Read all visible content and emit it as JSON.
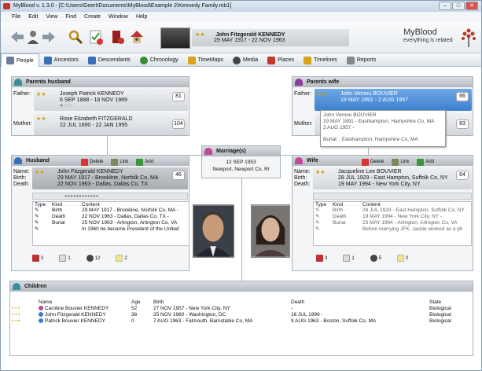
{
  "app": {
    "title": "MyBlood v. 1.3.0 - [C:\\Users\\Geert\\Documents\\MyBlood\\Example 2\\Kennedy Family.mb1]",
    "brand": "MyBlood",
    "tagline": "everything is related"
  },
  "window_controls": [
    "–",
    "□",
    "✕"
  ],
  "menu": [
    "File",
    "Edit",
    "View",
    "Find",
    "Create",
    "Window",
    "Help"
  ],
  "header": {
    "name": "John Fitzgerald KENNEDY",
    "dates": "29 MAY 1917 - 22 NOV 1963",
    "stars": "★★"
  },
  "tabs": [
    {
      "label": "People",
      "icon": "people-icon",
      "color": "#6a7c96",
      "active": true
    },
    {
      "label": "Ancestors",
      "icon": "ancestors-icon",
      "color": "#3b6fb6"
    },
    {
      "label": "Descendants",
      "icon": "descendants-icon",
      "color": "#3b6fb6"
    },
    {
      "label": "Chronology",
      "icon": "chronology-icon",
      "color": "#3a8a3a"
    },
    {
      "label": "TimeMaps",
      "icon": "timemaps-icon",
      "color": "#d9a21b"
    },
    {
      "label": "Media",
      "icon": "media-icon",
      "color": "#444"
    },
    {
      "label": "Places",
      "icon": "places-icon",
      "color": "#c0392b"
    },
    {
      "label": "Timelines",
      "icon": "timelines-icon",
      "color": "#d9a21b"
    },
    {
      "label": "Reports",
      "icon": "reports-icon",
      "color": "#888"
    }
  ],
  "parents_husband": {
    "title": "Parents husband",
    "father_label": "Father:",
    "father_name": "Joseph Patrick KENNEDY",
    "father_dates": "6 SEP 1888 - 18 NOV 1969",
    "father_num": "81",
    "mother_label": "Mother:",
    "mother_name": "Rose Elizabeth FITZGERALD",
    "mother_dates": "22 JUL 1890 - 22 JAN 1995",
    "mother_num": "104"
  },
  "parents_wife": {
    "title": "Parents wife",
    "father_label": "Father:",
    "father_name": "John Vernou BOUVIER",
    "father_dates": "19 MAY 1891 - 2 AUG 1957",
    "father_num": "66",
    "mother_label": "Mother:",
    "mother_num": "83"
  },
  "tooltip": {
    "line1": "John Vernou BOUVIER",
    "line2": "19 MAY 1891 - Easthampton, Hampshire Co, MA",
    "line3": "2 AUG 1957 -",
    "line4": "Burial: , Easthampton, Hampshire Co, MA"
  },
  "marriage": {
    "title": "Marriage(s)",
    "date": "12 SEP 1953",
    "place": "Newport, Newport Co, RI"
  },
  "husband": {
    "title": "Husband",
    "delete": "Delete",
    "link": "Link",
    "add": "Add",
    "name_label": "Name:",
    "birth_label": "Birth:",
    "death_label": "Death:",
    "name": "John Fitzgerald KENNEDY",
    "birth": "29 MAY 1917 - Brookline, Norfolk Co, MA",
    "death": "22 NOV 1963 - Dallas, Dallas Co, TX",
    "num": "46",
    "events": {
      "headers": [
        "Type",
        "Kind",
        "Content"
      ],
      "rows": [
        [
          "Birth",
          "29 MAY 1917 - Brookline, Norfolk Co, MA -"
        ],
        [
          "Death",
          "22 NOV 1963 - Dallas, Dallas Co, TX -"
        ],
        [
          "Burial",
          "25 NOV 1963 - Arlington, Arlington Co, VA"
        ],
        [
          "",
          "In 1960 he became President of the United"
        ]
      ]
    },
    "counts": [
      "3",
      "1",
      "12",
      "2"
    ]
  },
  "wife": {
    "title": "Wife",
    "delete": "Delete",
    "link": "Link",
    "add": "Add",
    "name_label": "Name:",
    "birth_label": "Birth:",
    "death_label": "Death:",
    "name": "Jacqueline Lee BOUVIER",
    "birth": "28 JUL 1929 - East Hampton, Suffolk Co, NY",
    "death": "19 MAY 1994 - New York City, NY",
    "num": "64",
    "events": {
      "headers": [
        "Type",
        "Kind",
        "Content"
      ],
      "rows": [
        [
          "Birth",
          "28 JUL 1929 - East Hampton, Suffolk Co, NY"
        ],
        [
          "Death",
          "19 MAY 1994 - New York City, NY -"
        ],
        [
          "Burial",
          "23 MAY 1994 - Arlington, Arlington Co, VA"
        ],
        [
          "",
          "Before marrying JFK, Jackie worked as a ph"
        ]
      ]
    },
    "counts": [
      "3",
      "1",
      "5",
      "0"
    ]
  },
  "children": {
    "title": "Children",
    "headers": [
      "Name",
      "Age",
      "Birth",
      "Death",
      "State"
    ],
    "rows": [
      {
        "name": "Caroline Bouvier KENNEDY",
        "age": "52",
        "birth": "27 NOV 1957 - New York City, NY",
        "death": "-",
        "state": "Biological",
        "color": "#c2469a"
      },
      {
        "name": "John Fitzgerald KENNEDY",
        "age": "38",
        "birth": "25 NOV 1960 - Washington, DC",
        "death": "16 JUL 1999 -",
        "state": "Biological",
        "color": "#3b7fd4"
      },
      {
        "name": "Patrick Bouvier KENNEDY",
        "age": "0",
        "birth": "7 AUG 1963 - Falmouth, Barnstable Co, MA",
        "death": "9 AUG 1963 - Boston, Suffolk Co, MA",
        "state": "Biological",
        "color": "#3b7fd4"
      }
    ]
  }
}
